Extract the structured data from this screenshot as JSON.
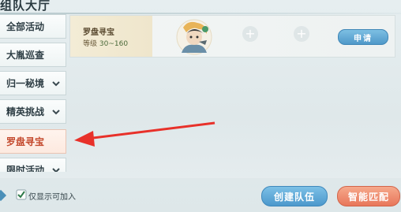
{
  "header": {
    "title": "组队大厅"
  },
  "sidebar": {
    "items": [
      {
        "label": "全部活动",
        "has_chevron": false
      },
      {
        "label": "大胤巡查",
        "has_chevron": false
      },
      {
        "label": "归一秘境",
        "has_chevron": true
      },
      {
        "label": "精英挑战",
        "has_chevron": true
      },
      {
        "label": "罗盘寻宝",
        "has_chevron": false,
        "active": true
      },
      {
        "label": "限时活动",
        "has_chevron": true
      }
    ]
  },
  "team": {
    "activity_name": "罗盘寻宝",
    "level_label": "等级",
    "level_range": "30~160",
    "empty_slot_symbol": "+",
    "apply_label": "申请"
  },
  "footer": {
    "checkbox_checked": true,
    "checkbox_label": "仅显示可加入",
    "create_team_label": "创建队伍",
    "smart_match_label": "智能匹配"
  },
  "colors": {
    "accent_blue": "#4c98cc",
    "accent_orange": "#e8765a",
    "active_text": "#c44a2e",
    "annotation_arrow": "#e8312a"
  }
}
